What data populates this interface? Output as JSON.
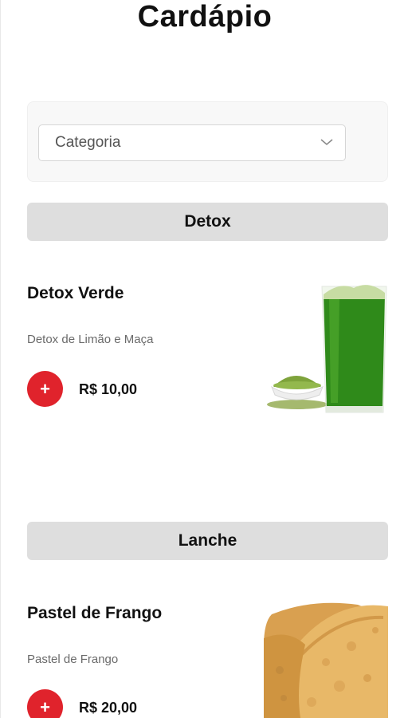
{
  "page": {
    "title": "Cardápio"
  },
  "filter": {
    "category_placeholder": "Categoria"
  },
  "sections": [
    {
      "title": "Detox",
      "items": [
        {
          "name": "Detox Verde",
          "description": "Detox de Limão e Maça",
          "price": "R$ 10,00",
          "add_label": "+"
        }
      ]
    },
    {
      "title": "Lanche",
      "items": [
        {
          "name": "Pastel de Frango",
          "description": "Pastel de Frango",
          "price": "R$ 20,00",
          "add_label": "+"
        }
      ]
    }
  ],
  "colors": {
    "accent": "#e0232c",
    "section_header_bg": "#dedede",
    "panel_bg": "#f8f8f8"
  }
}
